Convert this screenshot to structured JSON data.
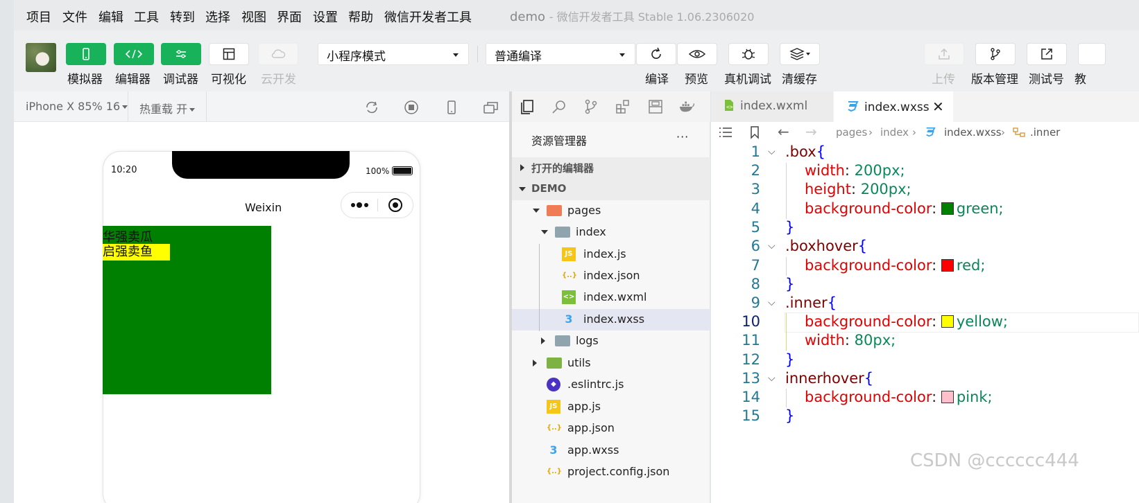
{
  "menu": {
    "items": [
      "项目",
      "文件",
      "编辑",
      "工具",
      "转到",
      "选择",
      "视图",
      "界面",
      "设置",
      "帮助",
      "微信开发者工具"
    ],
    "window_title": "demo",
    "window_subtitle": "- 微信开发者工具 Stable 1.06.2306020"
  },
  "toolbar": {
    "simulator_label": "模拟器",
    "editor_label": "编辑器",
    "debugger_label": "调试器",
    "visual_label": "可视化",
    "cloud_label": "云开发",
    "mode_select": "小程序模式",
    "compile_select": "普通编译",
    "compile_label": "编译",
    "preview_label": "预览",
    "remote_debug_label": "真机调试",
    "clear_cache_label": "清缓存",
    "upload_label": "上传",
    "version_label": "版本管理",
    "test_label": "测试号",
    "edu_label": "教"
  },
  "simulator": {
    "device": "iPhone X 85% 16",
    "hot_reload": "热重载 开",
    "time": "10:20",
    "battery": "100%",
    "nav_title": "Weixin",
    "box_text": "华强卖瓜",
    "inner_text": "启强卖鱼",
    "box_color": "#008000",
    "inner_color": "#ffff00"
  },
  "explorer": {
    "title": "资源管理器",
    "more": "···",
    "open_editors": "打开的编辑器",
    "project": "DEMO",
    "tree": [
      {
        "name": "pages",
        "kind": "folder-pages"
      },
      {
        "name": "index",
        "kind": "folder"
      },
      {
        "name": "index.js",
        "kind": "js"
      },
      {
        "name": "index.json",
        "kind": "json"
      },
      {
        "name": "index.wxml",
        "kind": "wxml"
      },
      {
        "name": "index.wxss",
        "kind": "wxss"
      },
      {
        "name": "logs",
        "kind": "folder"
      },
      {
        "name": "utils",
        "kind": "folder-utils"
      },
      {
        "name": ".eslintrc.js",
        "kind": "eslint"
      },
      {
        "name": "app.js",
        "kind": "js"
      },
      {
        "name": "app.json",
        "kind": "json"
      },
      {
        "name": "app.wxss",
        "kind": "wxss"
      },
      {
        "name": "project.config.json",
        "kind": "json"
      }
    ]
  },
  "editor": {
    "tabs": [
      "index.wxml",
      "index.wxss"
    ],
    "breadcrumb": [
      "pages",
      "index",
      "index.wxss",
      ".inner"
    ],
    "line_numbers": [
      "1",
      "2",
      "3",
      "4",
      "5",
      "6",
      "7",
      "8",
      "9",
      "10",
      "11",
      "12",
      "13",
      "14",
      "15"
    ],
    "lines": [
      {
        "sel": ".box",
        "open": "{"
      },
      {
        "prop": "width",
        "value": "200px;"
      },
      {
        "prop": "height",
        "value": "200px;"
      },
      {
        "prop": "background-color",
        "value": "green;",
        "swatch": "#008000"
      },
      {
        "close": "}"
      },
      {
        "sel": ".boxhover",
        "open": "{"
      },
      {
        "prop": "background-color",
        "value": "red;",
        "swatch": "#ff0000"
      },
      {
        "close": "}"
      },
      {
        "sel": ".inner",
        "open": "{"
      },
      {
        "prop": "background-color",
        "value": "yellow;",
        "swatch": "#ffff00"
      },
      {
        "prop": "width",
        "value": "80px;"
      },
      {
        "close": "}"
      },
      {
        "sel": "innerhover",
        "open": "{"
      },
      {
        "prop": "background-color",
        "value": "pink;",
        "swatch": "#ffc0cb"
      },
      {
        "close": "}"
      }
    ]
  },
  "watermark": "CSDN @cccccc444"
}
